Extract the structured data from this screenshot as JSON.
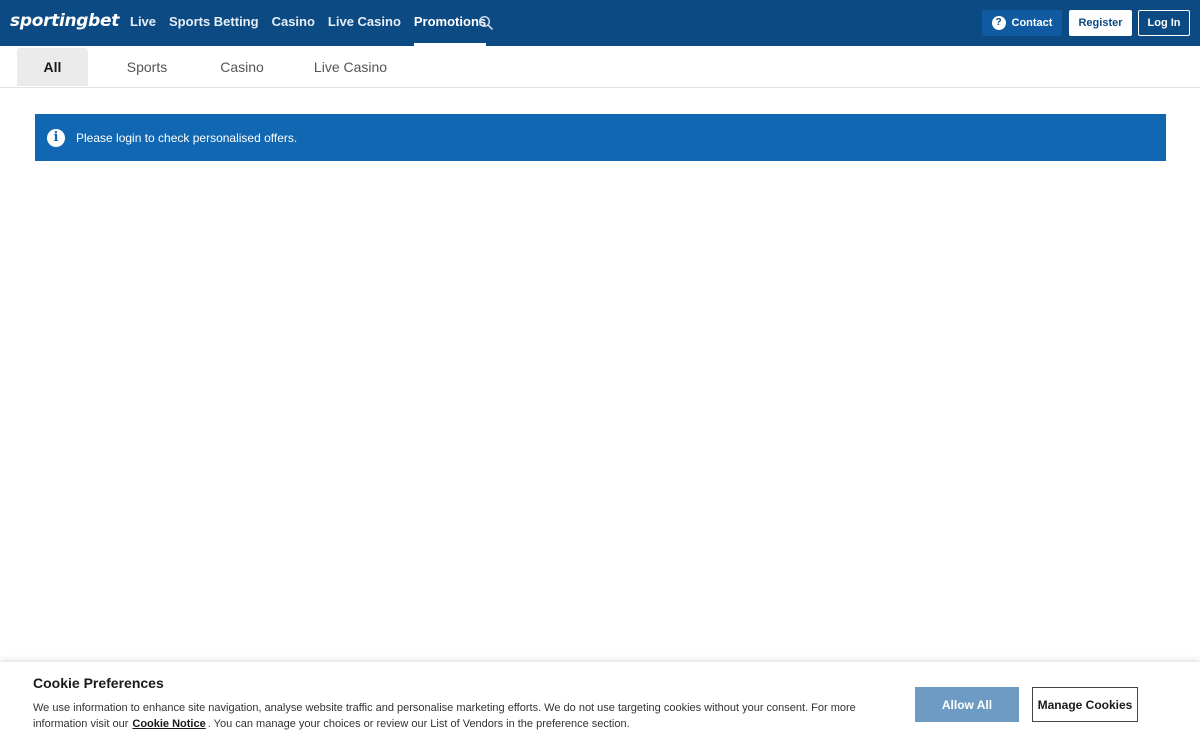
{
  "header": {
    "logo": "sportingbet",
    "nav": [
      "Live",
      "Sports Betting",
      "Casino",
      "Live Casino",
      "Promotions"
    ],
    "active_nav": "Promotions",
    "contact_label": "Contact",
    "register_label": "Register",
    "login_label": "Log In",
    "brand_color": "#0c4a83"
  },
  "tabs": {
    "items": [
      "All",
      "Sports",
      "Casino",
      "Live Casino"
    ],
    "active": "All"
  },
  "banner": {
    "text": "Please login to check personalised offers.",
    "color": "#1167b1"
  },
  "cookie": {
    "title": "Cookie Preferences",
    "text_before": "We use information to enhance site navigation, analyse website traffic and personalise marketing efforts. We do not use targeting cookies without your consent. For more information visit our",
    "link": "Cookie Notice",
    "text_after": ". You can manage your choices or review our List of Vendors in the preference section.",
    "allow_label": "Allow All",
    "manage_label": "Manage Cookies"
  }
}
